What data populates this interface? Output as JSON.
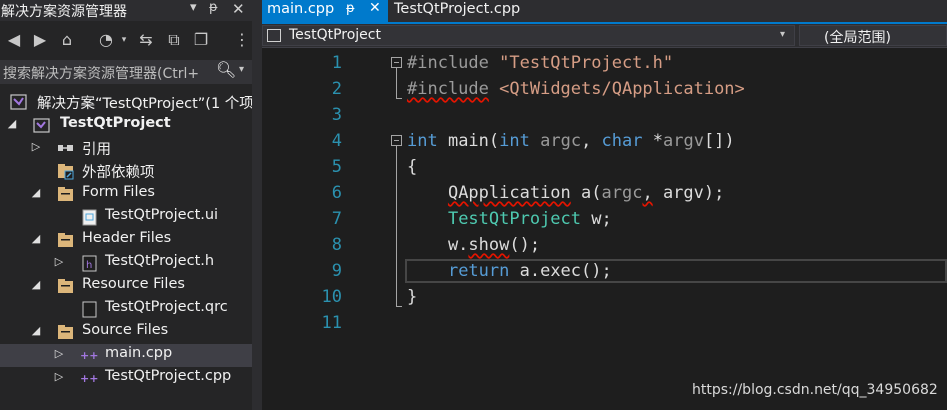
{
  "sidebar": {
    "title": "解决方案资源管理器",
    "search_placeholder": "搜索解决方案资源管理器(Ctrl+",
    "tree": [
      {
        "label": "解决方案“TestQtProject”(1 个项",
        "level": 0,
        "arrow": "",
        "icon": "solution-icon",
        "bold": false
      },
      {
        "label": "TestQtProject",
        "level": 1,
        "arrow": "◢",
        "icon": "project-icon",
        "bold": true
      },
      {
        "label": "引用",
        "level": 2,
        "arrow": "▷",
        "icon": "references-icon",
        "bold": false
      },
      {
        "label": "外部依赖项",
        "level": 2,
        "arrow": "",
        "icon": "external-deps-icon",
        "bold": false
      },
      {
        "label": "Form Files",
        "level": 2,
        "arrow": "◢",
        "icon": "folder-icon",
        "bold": false
      },
      {
        "label": "TestQtProject.ui",
        "level": 3,
        "arrow": "",
        "icon": "ui-file-icon",
        "bold": false
      },
      {
        "label": "Header Files",
        "level": 2,
        "arrow": "◢",
        "icon": "folder-icon",
        "bold": false
      },
      {
        "label": "TestQtProject.h",
        "level": 3,
        "arrow": "▷",
        "icon": "header-file-icon",
        "bold": false
      },
      {
        "label": "Resource Files",
        "level": 2,
        "arrow": "◢",
        "icon": "folder-icon",
        "bold": false
      },
      {
        "label": "TestQtProject.qrc",
        "level": 3,
        "arrow": "",
        "icon": "resource-file-icon",
        "bold": false
      },
      {
        "label": "Source Files",
        "level": 2,
        "arrow": "◢",
        "icon": "folder-icon",
        "bold": false
      },
      {
        "label": "main.cpp",
        "level": 3,
        "arrow": "▷",
        "icon": "cpp-file-icon",
        "bold": false,
        "selected": true
      },
      {
        "label": "TestQtProject.cpp",
        "level": 3,
        "arrow": "▷",
        "icon": "cpp-file-icon",
        "bold": false
      }
    ]
  },
  "tabs": [
    {
      "label": "main.cpp",
      "active": true
    },
    {
      "label": "TestQtProject.cpp",
      "active": false
    }
  ],
  "navbar": {
    "project": "TestQtProject",
    "scope": "(全局范围)"
  },
  "code": {
    "line_numbers": [
      "1",
      "2",
      "3",
      "4",
      "5",
      "6",
      "7",
      "8",
      "9",
      "10",
      "11"
    ]
  },
  "watermark": "https://blog.csdn.net/qq_34950682",
  "colors": {
    "accent": "#007acc",
    "keyword": "#569cd6",
    "type": "#4ec9b0",
    "string": "#d69d85",
    "line_number": "#2b91af",
    "background": "#1e1e1e"
  }
}
